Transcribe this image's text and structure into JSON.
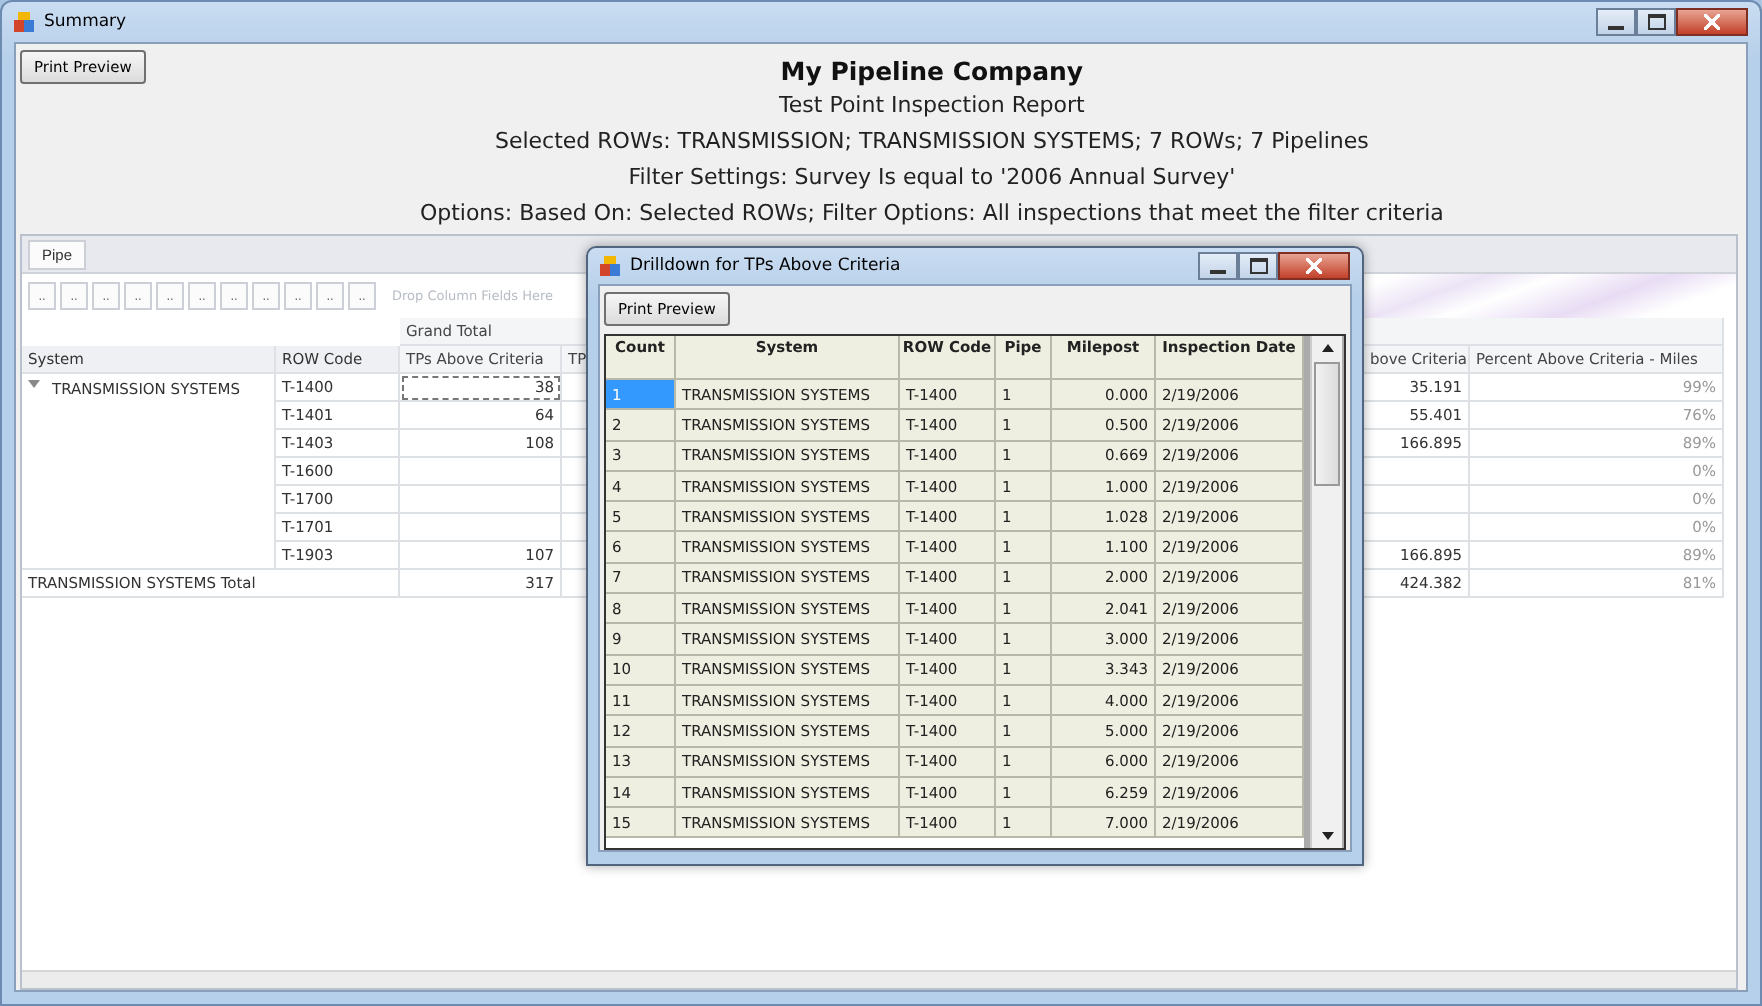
{
  "window": {
    "title": "Summary"
  },
  "toolbar": {
    "print_preview": "Print Preview"
  },
  "report": {
    "title": "My Pipeline Company",
    "lines": [
      "Test Point Inspection Report",
      "Selected ROWs: TRANSMISSION; TRANSMISSION SYSTEMS; 7 ROWs; 7 Pipelines",
      "Filter Settings: Survey Is equal to '2006 Annual Survey'",
      "Options: Based On: Selected ROWs; Filter Options: All inspections that meet the filter criteria"
    ]
  },
  "pivot": {
    "filter_fields": [
      "Pipe"
    ],
    "column_field_buttons": [
      "..",
      "..",
      "..",
      "..",
      "..",
      "..",
      "..",
      "..",
      "..",
      "..",
      ".."
    ],
    "drop_hint": "Drop Column Fields Here",
    "grand_total": "Grand Total",
    "row_headers": [
      "System",
      "ROW Code"
    ],
    "columns": [
      "TPs Above Criteria",
      "TP",
      "bove Criteria",
      "Percent Above Criteria - Miles"
    ],
    "groups": [
      {
        "name": "TRANSMISSION SYSTEMS",
        "expanded": true,
        "rows": [
          {
            "row_code": "T-1400",
            "focused": true,
            "tps_above_criteria": "38",
            "column_3": "35.191",
            "percent_above_criteria_miles": "99%"
          },
          {
            "row_code": "T-1401",
            "focused": false,
            "tps_above_criteria": "64",
            "column_3": "55.401",
            "percent_above_criteria_miles": "76%"
          },
          {
            "row_code": "T-1403",
            "focused": false,
            "tps_above_criteria": "108",
            "column_3": "166.895",
            "percent_above_criteria_miles": "89%"
          },
          {
            "row_code": "T-1600",
            "focused": false,
            "percent_above_criteria_miles": "0%"
          },
          {
            "row_code": "T-1700",
            "focused": false,
            "percent_above_criteria_miles": "0%"
          },
          {
            "row_code": "T-1701",
            "focused": false,
            "percent_above_criteria_miles": "0%"
          },
          {
            "row_code": "T-1903",
            "focused": false,
            "tps_above_criteria": "107",
            "column_3": "166.895",
            "percent_above_criteria_miles": "89%"
          }
        ],
        "total": {
          "label": "TRANSMISSION SYSTEMS Total",
          "tps_above_criteria": "317",
          "column_3": "424.382",
          "percent_above_criteria_miles": "81%"
        }
      }
    ]
  },
  "dialog": {
    "title": "Drilldown for TPs Above Criteria",
    "print_preview": "Print Preview",
    "columns": [
      "Count",
      "System",
      "ROW Code",
      "Pipe",
      "Milepost",
      "Inspection Date"
    ],
    "rows": [
      {
        "selected": true,
        "cells": [
          "1",
          "TRANSMISSION SYSTEMS",
          "T-1400",
          "1",
          "0.000",
          "2/19/2006"
        ]
      },
      {
        "selected": false,
        "cells": [
          "2",
          "TRANSMISSION SYSTEMS",
          "T-1400",
          "1",
          "0.500",
          "2/19/2006"
        ]
      },
      {
        "selected": false,
        "cells": [
          "3",
          "TRANSMISSION SYSTEMS",
          "T-1400",
          "1",
          "0.669",
          "2/19/2006"
        ]
      },
      {
        "selected": false,
        "cells": [
          "4",
          "TRANSMISSION SYSTEMS",
          "T-1400",
          "1",
          "1.000",
          "2/19/2006"
        ]
      },
      {
        "selected": false,
        "cells": [
          "5",
          "TRANSMISSION SYSTEMS",
          "T-1400",
          "1",
          "1.028",
          "2/19/2006"
        ]
      },
      {
        "selected": false,
        "cells": [
          "6",
          "TRANSMISSION SYSTEMS",
          "T-1400",
          "1",
          "1.100",
          "2/19/2006"
        ]
      },
      {
        "selected": false,
        "cells": [
          "7",
          "TRANSMISSION SYSTEMS",
          "T-1400",
          "1",
          "2.000",
          "2/19/2006"
        ]
      },
      {
        "selected": false,
        "cells": [
          "8",
          "TRANSMISSION SYSTEMS",
          "T-1400",
          "1",
          "2.041",
          "2/19/2006"
        ]
      },
      {
        "selected": false,
        "cells": [
          "9",
          "TRANSMISSION SYSTEMS",
          "T-1400",
          "1",
          "3.000",
          "2/19/2006"
        ]
      },
      {
        "selected": false,
        "cells": [
          "10",
          "TRANSMISSION SYSTEMS",
          "T-1400",
          "1",
          "3.343",
          "2/19/2006"
        ]
      },
      {
        "selected": false,
        "cells": [
          "11",
          "TRANSMISSION SYSTEMS",
          "T-1400",
          "1",
          "4.000",
          "2/19/2006"
        ]
      },
      {
        "selected": false,
        "cells": [
          "12",
          "TRANSMISSION SYSTEMS",
          "T-1400",
          "1",
          "5.000",
          "2/19/2006"
        ]
      },
      {
        "selected": false,
        "cells": [
          "13",
          "TRANSMISSION SYSTEMS",
          "T-1400",
          "1",
          "6.000",
          "2/19/2006"
        ]
      },
      {
        "selected": false,
        "cells": [
          "14",
          "TRANSMISSION SYSTEMS",
          "T-1400",
          "1",
          "6.259",
          "2/19/2006"
        ]
      },
      {
        "selected": false,
        "cells": [
          "15",
          "TRANSMISSION SYSTEMS",
          "T-1400",
          "1",
          "7.000",
          "2/19/2006"
        ]
      }
    ]
  }
}
